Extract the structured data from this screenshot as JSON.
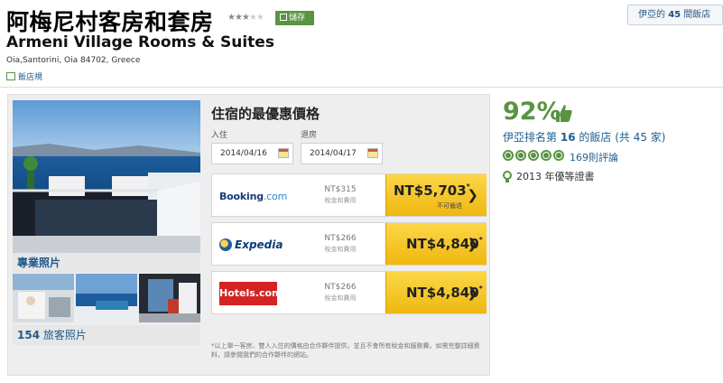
{
  "hotel": {
    "name_cn": "阿梅尼村客房和套房",
    "name_en": "Armeni Village Rooms & Suites",
    "address": "Oia,Santorini, Oia 84702, Greece",
    "edit_link": "飯店規",
    "star_rating": 3,
    "star_max": 5
  },
  "save_button": {
    "label": "儲存"
  },
  "top_link": {
    "prefix": "伊亞的",
    "count": "45",
    "suffix": "間飯店"
  },
  "photos": {
    "main_label": "專業照片",
    "guest_count": "154",
    "guest_label": "旅客照片"
  },
  "deals": {
    "title": "住宿的最優惠價格",
    "checkin_label": "入住",
    "checkout_label": "退房",
    "checkin_date": "2014/04/16",
    "checkout_date": "2014/04/17",
    "rows": [
      {
        "provider": "Booking.com",
        "logo_main": "Booking",
        "logo_suffix": ".com",
        "tax": "NT$315",
        "tax_note": "稅金和費用",
        "price": "NT$5,703",
        "sup": "*",
        "note": "不可循退"
      },
      {
        "provider": "Expedia",
        "logo_main": "Expedia",
        "logo_suffix": "",
        "tax": "NT$266",
        "tax_note": "稅金和費用",
        "price": "NT$4,840",
        "sup": "*",
        "note": ""
      },
      {
        "provider": "Hotels.com",
        "logo_main": "Hotels.com",
        "logo_suffix": "",
        "tax": "NT$266",
        "tax_note": "稅金和費用",
        "price": "NT$4,840",
        "sup": "*",
        "note": ""
      }
    ],
    "disclaimer": "*以上單一客房、雙人入住的價格由合作夥伴提供，並且不會所有稅金和服務費。如需完整詳細資料，請參閱我們的合作夥伴的網站。"
  },
  "ratings": {
    "score": "92%",
    "rank_prefix": "伊亞排名第",
    "rank": "16",
    "rank_mid": "的飯店",
    "rank_total": "(共 45 家)",
    "bubbles": 5,
    "reviews": "169則評論",
    "certificate": "2013 年優等證書"
  },
  "colors": {
    "accent_green": "#589442",
    "link_blue": "#1f5f8e",
    "price_yellow": "#f5c21f",
    "hotels_red": "#d32323"
  }
}
